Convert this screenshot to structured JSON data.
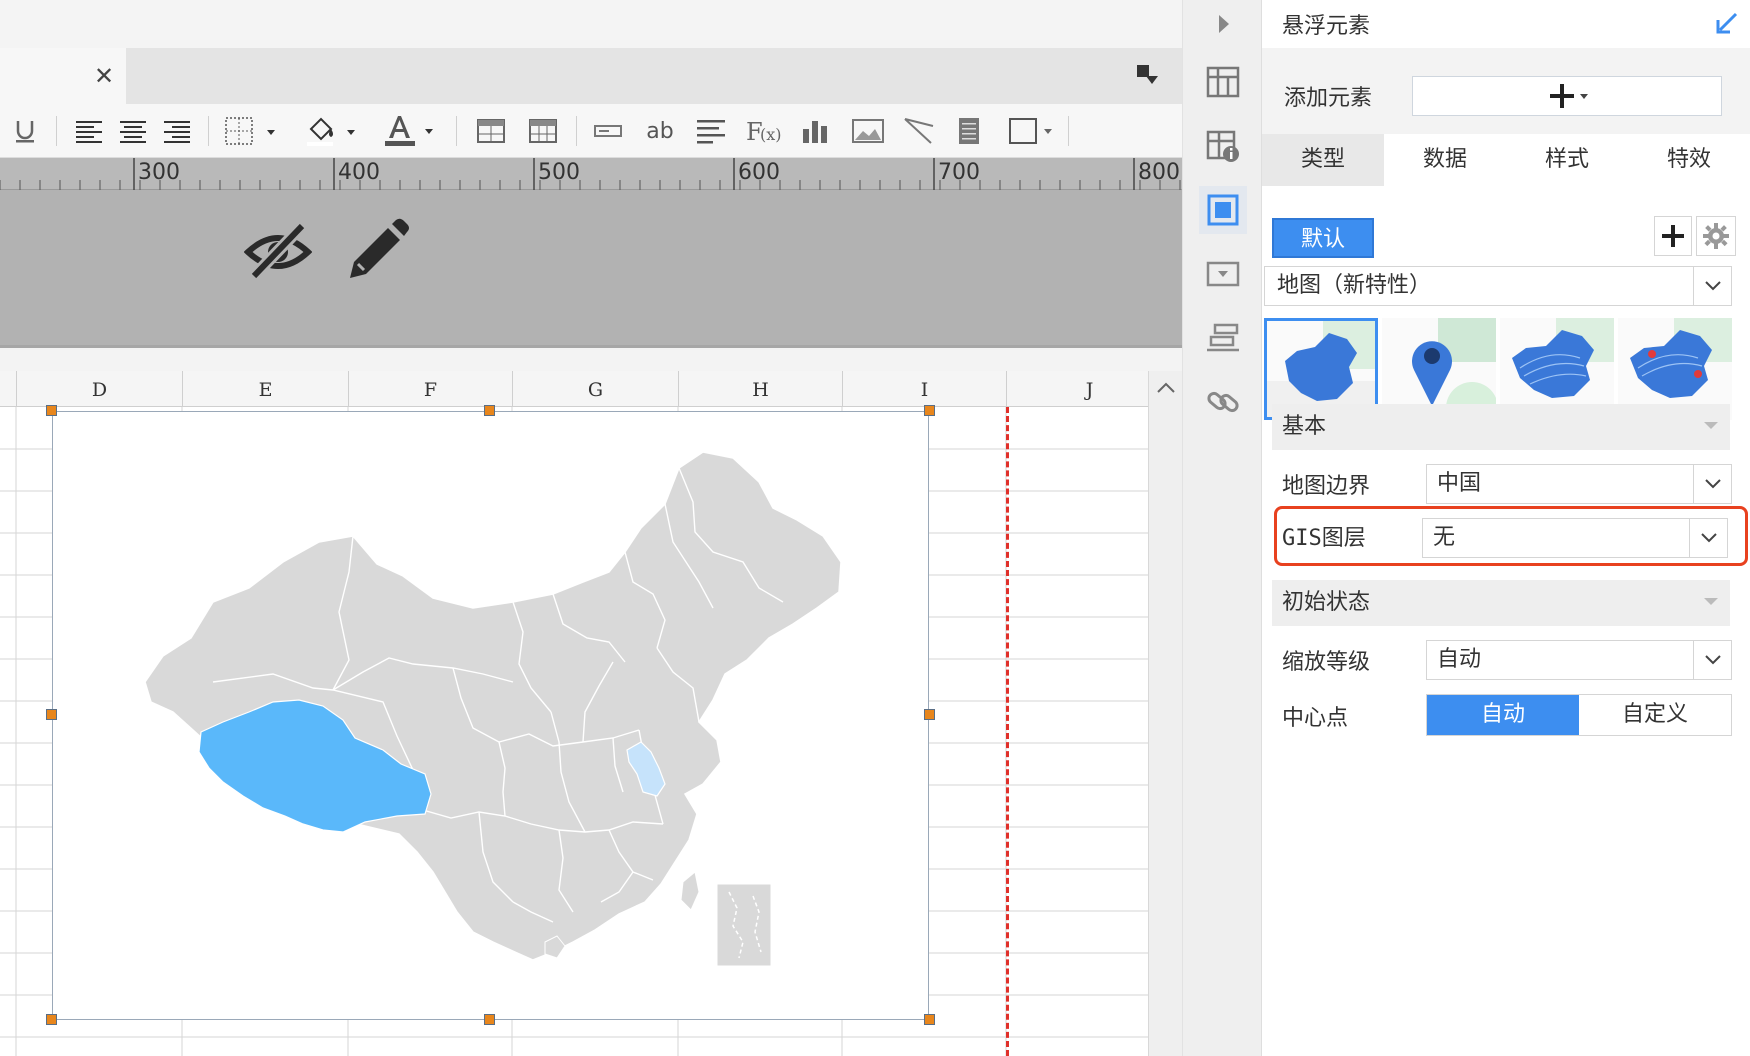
{
  "editor": {
    "ruler_labels": [
      "300",
      "400",
      "500",
      "600",
      "700",
      "800"
    ],
    "toolbar": {
      "text_label": "ab"
    },
    "columns": [
      "D",
      "E",
      "F",
      "G",
      "H",
      "I",
      "J"
    ]
  },
  "props": {
    "title": "悬浮元素",
    "add_label": "添加元素",
    "tabs": [
      "类型",
      "数据",
      "样式",
      "特效"
    ],
    "default_label": "默认",
    "map_type": "地图（新特性）",
    "basic_section": "基本",
    "boundary_label": "地图边界",
    "boundary_value": "中国",
    "gis_label": "GIS图层",
    "gis_value": "无",
    "init_section": "初始状态",
    "zoom_label": "缩放等级",
    "zoom_value": "自动",
    "center_label": "中心点",
    "center_options": [
      "自动",
      "自定义"
    ]
  },
  "colors": {
    "accent": "#3d8ef0",
    "highlight": "#e8411f",
    "map_land": "#d9d9d9",
    "map_selected": "#5ab8fa",
    "map_secondary": "#c6e3fb"
  }
}
